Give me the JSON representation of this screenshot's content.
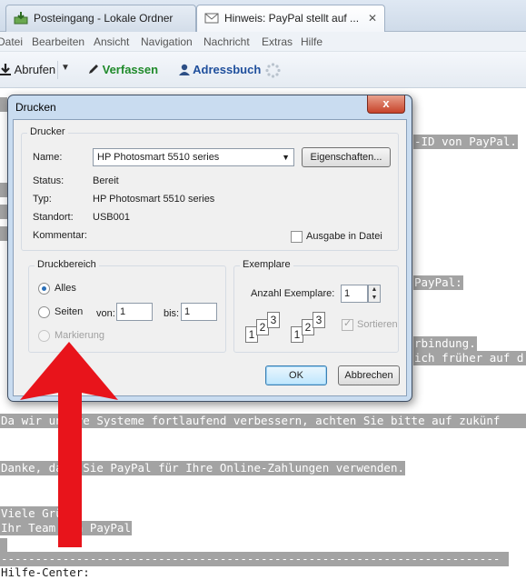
{
  "tabs": [
    {
      "label": "Posteingang - Lokale Ordner",
      "icon": "inbox-download-icon"
    },
    {
      "label": "Hinweis: PayPal stellt auf ...",
      "icon": "envelope-icon",
      "close": "✕"
    }
  ],
  "menubar": [
    "Datei",
    "Bearbeiten",
    "Ansicht",
    "Navigation",
    "Nachricht",
    "Extras",
    "Hilfe"
  ],
  "toolbar": {
    "fetch_label": "Abrufen",
    "compose_label": "Verfassen",
    "addressbook_label": "Adressbuch"
  },
  "message_lines": [
    "-ID von PayPal.",
    "PayPal:",
    "rbindung.",
    "ich früher auf d",
    "Da wir unsere Systeme fortlaufend verbessern, achten Sie bitte auf zukünf",
    "Danke, dass Sie PayPal für Ihre Online-Zahlungen verwenden.",
    "Viele Grüße",
    "Ihr Team von PayPal",
    "-------------------------------------------------------------------------",
    "Hilfe-Center:"
  ],
  "dialog": {
    "title": "Drucken",
    "close": "x",
    "printer_group": "Drucker",
    "name_label": "Name:",
    "printer_name": "HP Photosmart 5510 series",
    "properties_button": "Eigenschaften...",
    "status_label": "Status:",
    "status_value": "Bereit",
    "type_label": "Typ:",
    "type_value": "HP Photosmart 5510 series",
    "location_label": "Standort:",
    "location_value": "USB001",
    "comment_label": "Kommentar:",
    "print_to_file": "Ausgabe in Datei",
    "range_group": "Druckbereich",
    "range_all": "Alles",
    "range_pages": "Seiten",
    "from_label": "von:",
    "from_value": "1",
    "to_label": "bis:",
    "to_value": "1",
    "range_selection": "Markierung",
    "copies_group": "Exemplare",
    "copies_label": "Anzahl Exemplare:",
    "copies_value": "1",
    "collate_label": "Sortieren",
    "ok_button": "OK",
    "cancel_button": "Abbrechen"
  },
  "colors": {
    "arrow": "#e8141b",
    "highlight": "#a3a3a3",
    "compose_green": "#1f8a2a",
    "addressbook_blue": "#1f4f9c"
  }
}
